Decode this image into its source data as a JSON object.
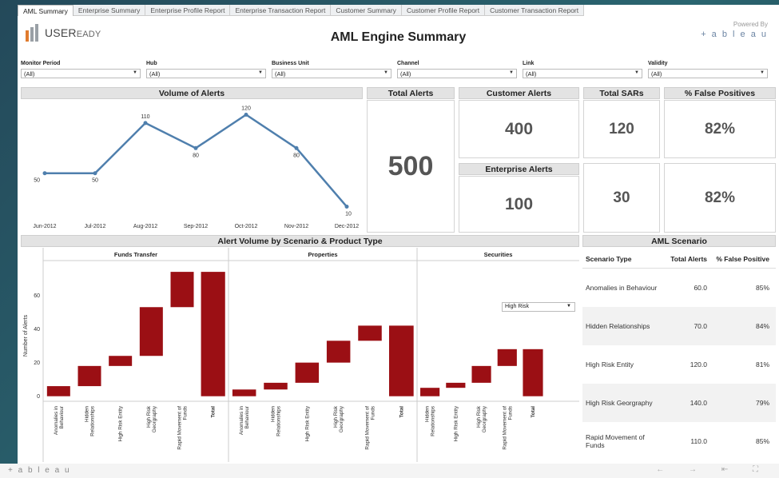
{
  "tabs": [
    "AML Summary",
    "Enterprise Summary",
    "Enterprise Profile Report",
    "Enterprise Transaction Report",
    "Customer Summary",
    "Customer Profile Report",
    "Customer Transaction Report"
  ],
  "logo": {
    "text_a": "USER",
    "text_b": "EADY"
  },
  "title": "AML Engine Summary",
  "powered": {
    "label": "Powered By",
    "brand": "+ a b l e a u"
  },
  "filters": [
    {
      "label": "Monitor Period",
      "value": "(All)"
    },
    {
      "label": "Hub",
      "value": "(All)"
    },
    {
      "label": "Business Unit",
      "value": "(All)"
    },
    {
      "label": "Channel",
      "value": "(All)"
    },
    {
      "label": "Link",
      "value": "(All)"
    },
    {
      "label": "Validity",
      "value": "(All)"
    }
  ],
  "kpis": {
    "total_alerts_title": "Total Alerts",
    "total_alerts": "500",
    "customer_alerts_title": "Customer Alerts",
    "customer_alerts": "400",
    "enterprise_alerts_title": "Enterprise Alerts",
    "enterprise_alerts": "100",
    "total_sars_title": "Total SARs",
    "sars_customer": "120",
    "sars_enterprise": "30",
    "false_pos_title": "% False Positives",
    "fp_customer": "82%",
    "fp_enterprise": "82%"
  },
  "chart_data": [
    {
      "type": "line",
      "title": "Volume of Alerts",
      "categories": [
        "Jun-2012",
        "Jul-2012",
        "Aug-2012",
        "Sep-2012",
        "Oct-2012",
        "Nov-2012",
        "Dec-2012"
      ],
      "values": [
        50,
        50,
        110,
        80,
        120,
        80,
        10
      ],
      "ylim": [
        0,
        130
      ],
      "color": "#4f7fad"
    },
    {
      "type": "bar",
      "title": "Alert Volume by Scenario & Product Type",
      "ylabel": "Number of Alerts",
      "yticks": [
        0,
        20,
        40,
        60
      ],
      "ylim": [
        -3,
        75
      ],
      "color": "#9b0f14",
      "groups": [
        {
          "name": "Funds Transfer",
          "categories": [
            "Anomalies in Behaviour",
            "Hidden Relationships",
            "High Risk Entity",
            "High Risk Georgraphy",
            "Rapid Movement of Funds",
            "Total"
          ],
          "ranges": [
            [
              0,
              6
            ],
            [
              6,
              18
            ],
            [
              18,
              24
            ],
            [
              24,
              53
            ],
            [
              53,
              74
            ],
            [
              0,
              74
            ]
          ]
        },
        {
          "name": "Properties",
          "categories": [
            "Anomalies in Behaviour",
            "Hidden Relationships",
            "High Risk Entity",
            "High Risk Georgraphy",
            "Rapid Movement of Funds",
            "Total"
          ],
          "ranges": [
            [
              0,
              4
            ],
            [
              4,
              8
            ],
            [
              8,
              20
            ],
            [
              20,
              33
            ],
            [
              33,
              42
            ],
            [
              0,
              42
            ]
          ]
        },
        {
          "name": "Securities",
          "categories": [
            "Hidden Relationships",
            "High Risk Entity",
            "High Risk Georgraphy",
            "Rapid Movement of Funds",
            "Total"
          ],
          "ranges": [
            [
              0,
              5
            ],
            [
              5,
              8
            ],
            [
              8,
              18
            ],
            [
              18,
              28
            ],
            [
              0,
              28
            ]
          ]
        }
      ]
    }
  ],
  "risk_select": "High Risk",
  "scenario_table": {
    "title": "AML Scenario",
    "headers": [
      "Scenario Type",
      "Total Alerts",
      "% False Positive"
    ],
    "rows": [
      [
        "Anomalies in Behaviour",
        "60.0",
        "85%"
      ],
      [
        "Hidden Relationships",
        "70.0",
        "84%"
      ],
      [
        "High Risk Entity",
        "120.0",
        "81%"
      ],
      [
        "High Risk Georgraphy",
        "140.0",
        "79%"
      ],
      [
        "Rapid Movement of Funds",
        "110.0",
        "85%"
      ]
    ]
  },
  "footer": {
    "brand": "+ a b l e a u",
    "nav": "← → ⇤ ⛶"
  }
}
